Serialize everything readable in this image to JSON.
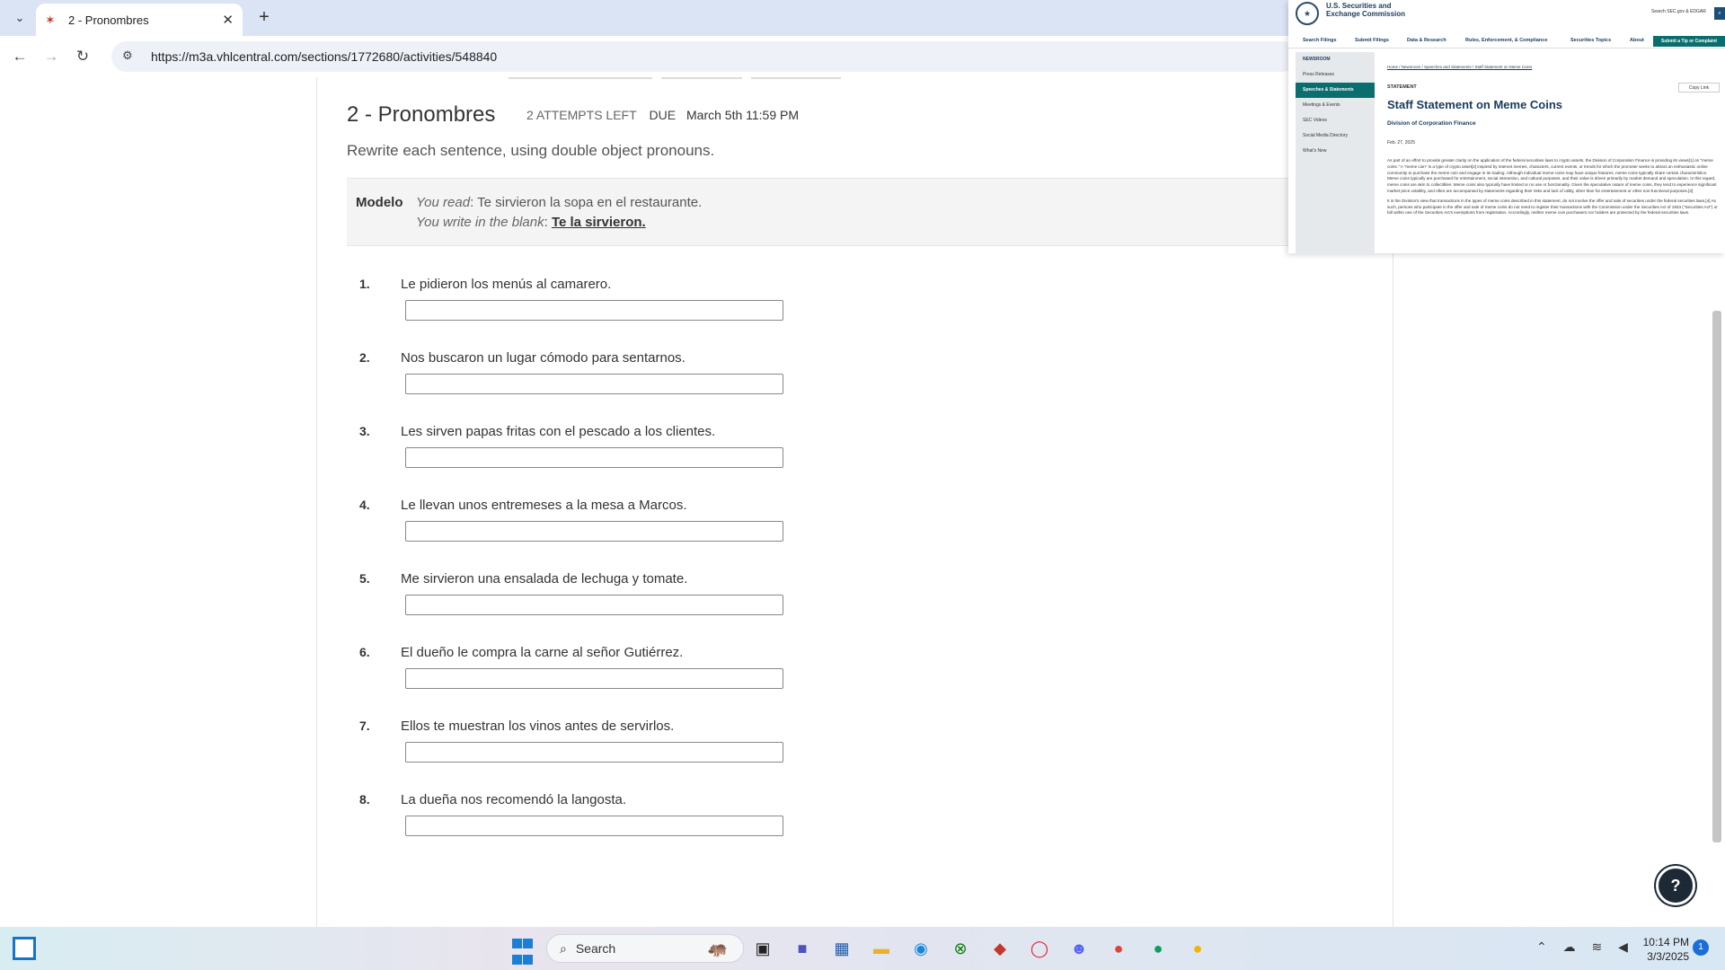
{
  "browser": {
    "tab_title": "2 - Pronombres",
    "url": "https://m3a.vhlcentral.com/sections/1772680/activities/548840"
  },
  "activity": {
    "title": "2 - Pronombres",
    "attempts": "2 ATTEMPTS LEFT",
    "due_label": "DUE",
    "due_value": "March 5th 11:59 PM",
    "instructions": "Rewrite each sentence, using double object pronouns.",
    "model": {
      "label": "Modelo",
      "read_label": "You read",
      "read_text": ": Te sirvieron la sopa en el restaurante.",
      "write_label": "You write in the blank",
      "write_sep": ": ",
      "write_answer": "Te la sirvieron."
    },
    "questions": [
      {
        "num": "1.",
        "text": "Le pidieron los menús al camarero.",
        "value": ""
      },
      {
        "num": "2.",
        "text": "Nos buscaron un lugar cómodo para sentarnos.",
        "value": ""
      },
      {
        "num": "3.",
        "text": "Les sirven papas fritas con el pescado a los clientes.",
        "value": ""
      },
      {
        "num": "4.",
        "text": "Le llevan unos entremeses a la mesa a Marcos.",
        "value": ""
      },
      {
        "num": "5.",
        "text": "Me sirvieron una ensalada de lechuga y tomate.",
        "value": ""
      },
      {
        "num": "6.",
        "text": "El dueño le compra la carne al señor Gutiérrez.",
        "value": ""
      },
      {
        "num": "7.",
        "text": "Ellos te muestran los vinos antes de servirlos.",
        "value": ""
      },
      {
        "num": "8.",
        "text": "La dueña nos recomendó la langosta.",
        "value": ""
      }
    ]
  },
  "sec": {
    "name_line1": "U.S. Securities and",
    "name_line2": "Exchange Commission",
    "search": "Search SEC.gov & EDGAR",
    "nav": [
      "Search Filings",
      "Submit Filings",
      "Data & Research",
      "Rules, Enforcement, & Compliance",
      "Securities Topics",
      "About"
    ],
    "tip_button": "Submit a Tip or Complaint",
    "sidebar": [
      "NEWSROOM",
      "Press Releases",
      "Speeches & Statements",
      "Meetings & Events",
      "SEC Videos",
      "Social Media Directory",
      "What's New"
    ],
    "breadcrumb": "Home / Newsroom / Speeches and Statements / Staff Statement on Meme Coins",
    "kind": "STATEMENT",
    "copy_link": "Copy Link",
    "title": "Staff Statement on Meme Coins",
    "division": "Division of Corporation Finance",
    "date": "Feb. 27, 2025",
    "body1": "As part of an effort to provide greater clarity on the application of the federal securities laws to crypto assets, the Division of Corporation Finance is providing its views[1] on \"meme coins.\" A \"meme coin\" is a type of crypto asset[2] inspired by internet memes, characters, current events, or trends for which the promoter seeks to attract an enthusiastic online community to purchase the meme coin and engage in its trading. Although individual meme coins may have unique features, meme coins typically share certain characteristics. Meme coins typically are purchased for entertainment, social interaction, and cultural purposes, and their value is driven primarily by market demand and speculation. In this regard, meme coins are akin to collectibles. Meme coins also typically have limited or no use or functionality. Given the speculative nature of meme coins, they tend to experience significant market price volatility, and often are accompanied by statements regarding their risks and lack of utility, other than for entertainment or other non-functional purposes.[3]",
    "body2": "It is the Division's view that transactions in the types of meme coins described in this statement, do not involve the offer and sale of securities under the federal securities laws.[4] As such, persons who participate in the offer and sale of meme coins do not need to register their transactions with the Commission under the Securities Act of 1933 (\"Securities Act\") or fall within one of the Securities Act's exemptions from registration. Accordingly, neither meme coin purchasers nor holders are protected by the federal securities laws."
  },
  "taskbar": {
    "search_placeholder": "Search",
    "time": "10:14 PM",
    "date": "3/3/2025",
    "notifications": "1"
  }
}
